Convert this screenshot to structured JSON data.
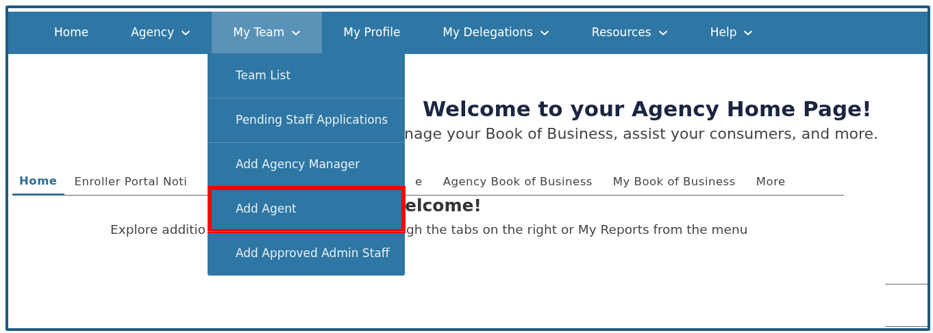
{
  "nav": [
    {
      "label": "Home",
      "has_menu": false,
      "selected": false
    },
    {
      "label": "Agency",
      "has_menu": true,
      "selected": false
    },
    {
      "label": "My Team",
      "has_menu": true,
      "selected": true
    },
    {
      "label": "My Profile",
      "has_menu": false,
      "selected": false
    },
    {
      "label": "My Delegations",
      "has_menu": true,
      "selected": false
    },
    {
      "label": "Resources",
      "has_menu": true,
      "selected": false
    },
    {
      "label": "Help",
      "has_menu": true,
      "selected": false
    }
  ],
  "dropdown": {
    "items": [
      {
        "label": "Team List",
        "highlighted": false
      },
      {
        "label": "Pending Staff Applications",
        "highlighted": false
      },
      {
        "label": "Add Agency Manager",
        "highlighted": false
      },
      {
        "label": "Add Agent",
        "highlighted": true
      },
      {
        "label": "Add Approved Admin Staff",
        "highlighted": false
      }
    ]
  },
  "header": {
    "title": "Welcome to your Agency Home Page!",
    "subtitle": "nage your Book of Business, assist your consumers, and more."
  },
  "tabs": [
    {
      "label": "Home",
      "selected": true
    },
    {
      "label": "Enroller Portal Noti",
      "selected": false
    },
    {
      "label": "e",
      "selected": false
    },
    {
      "label": "Agency Book of Business",
      "selected": false
    },
    {
      "label": "My Book of Business",
      "selected": false
    },
    {
      "label": "More",
      "selected": false
    }
  ],
  "welcome": {
    "heading": "elcome!",
    "text_left": "Explore additio",
    "text_right": "gh the tabs on the right or My Reports from the menu"
  }
}
